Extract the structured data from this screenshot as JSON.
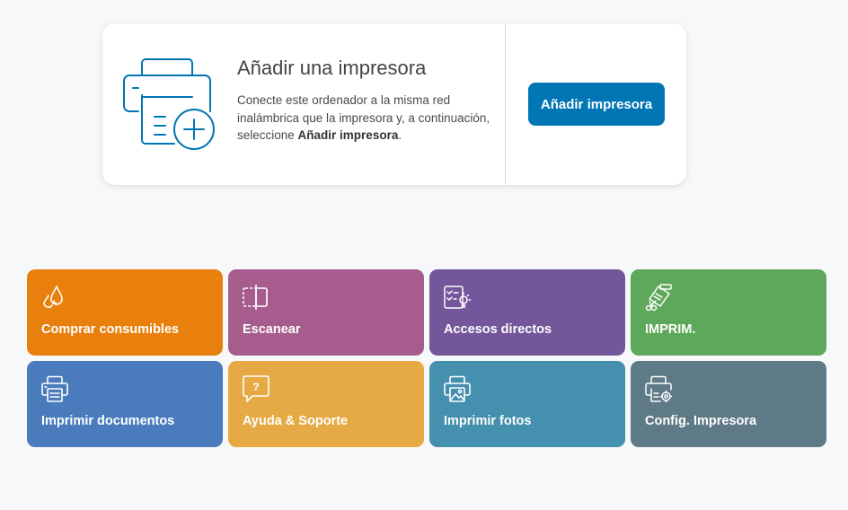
{
  "add_printer_card": {
    "title": "Añadir una impresora",
    "description_before": "Conecte este ordenador a la misma red inalámbrica que la impresora y, a continuación, seleccione ",
    "description_bold": "Añadir impresora",
    "description_after": ".",
    "button_label": "Añadir impresora",
    "illustration_icon": "printer-add-icon",
    "accent_color": "#0176b4"
  },
  "tiles": [
    {
      "label": "Comprar consumibles",
      "icon": "ink-drops-icon",
      "color": "#e9800e"
    },
    {
      "label": "Escanear",
      "icon": "scan-icon",
      "color": "#a65c8c"
    },
    {
      "label": "Accesos directos",
      "icon": "shortcuts-icon",
      "color": "#74569b"
    },
    {
      "label": "IMPRIM.",
      "icon": "print-anywhere-icon",
      "color": "#5da85a"
    },
    {
      "label": "Imprimir documentos",
      "icon": "printer-icon",
      "color": "#4a7bbd"
    },
    {
      "label": "Ayuda & Soporte",
      "icon": "help-chat-icon",
      "color": "#e6aa44"
    },
    {
      "label": "Imprimir fotos",
      "icon": "photo-printer-icon",
      "color": "#458faf"
    },
    {
      "label": "Config. Impresora",
      "icon": "printer-settings-icon",
      "color": "#5f7a87"
    }
  ]
}
